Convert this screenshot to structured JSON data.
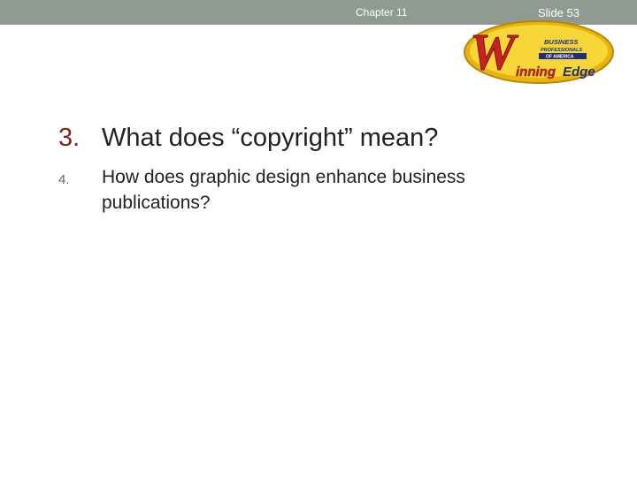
{
  "header": {
    "chapter": "Chapter 11",
    "slide": "Slide 53"
  },
  "logo": {
    "line1": "BUSINESS",
    "line2": "PROFESSIONALS",
    "line3": "OF AMERICA",
    "letter": "W",
    "word_inning": "inning",
    "word_edge": "Edge"
  },
  "questions": [
    {
      "number": "3.",
      "text": "What does “copyright” mean?"
    },
    {
      "number": "4.",
      "text": "How does graphic design enhance business publications?"
    }
  ],
  "colors": {
    "bar": "#8f9a90",
    "accent_red": "#8a1f1a",
    "logo_gold": "#f2c418",
    "logo_red": "#c8231d"
  }
}
